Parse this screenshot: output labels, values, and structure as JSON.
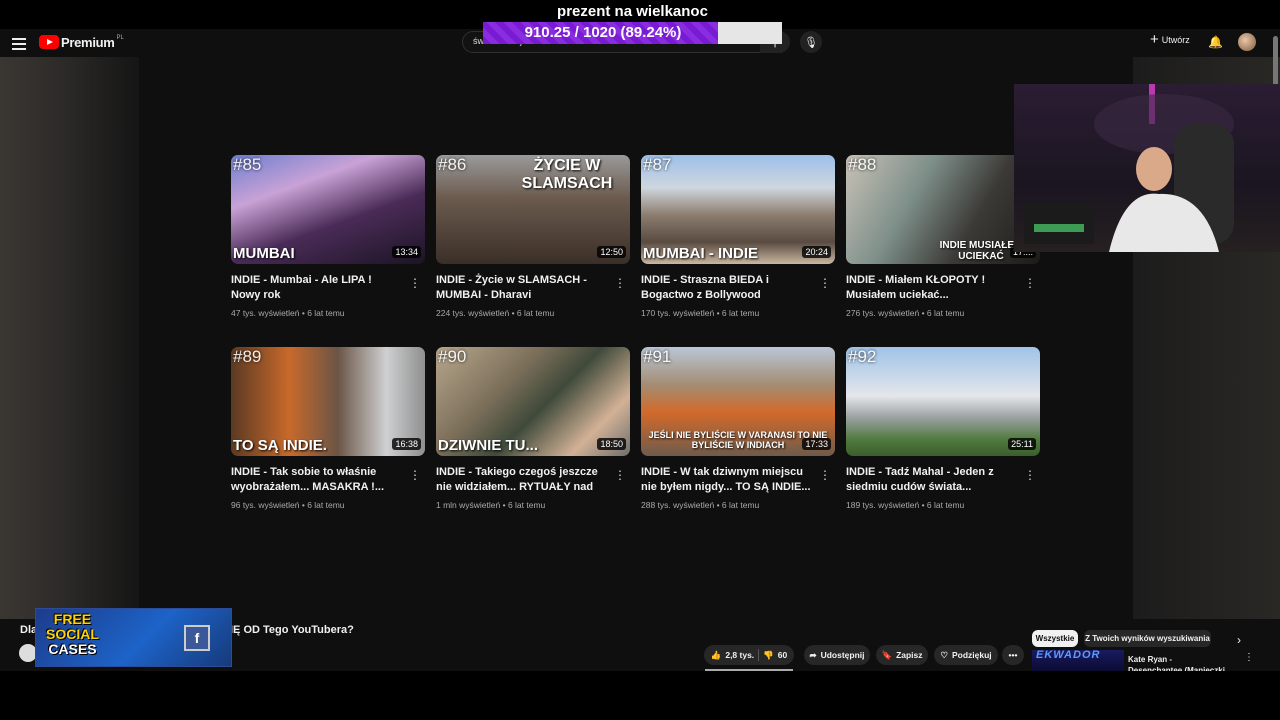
{
  "overlay": {
    "title": "prezent na wielkanoc",
    "progress_text": "910.25 / 1020 (89.24%)",
    "progress_fraction": 0.8924
  },
  "topbar": {
    "logo": "Premium",
    "logo_region": "PL",
    "search_value": "świat intencja",
    "create_label": "Utwórz"
  },
  "videos": [
    {
      "number": "#85",
      "caption": "MUMBAI",
      "duration": "13:34",
      "title": "INDIE - Mumbai - Ale LIPA ! Nowy rok",
      "meta": "47 tys. wyświetleń • 6 lat temu"
    },
    {
      "number": "#86",
      "caption": "ŻYCIE W SLAMSACH",
      "duration": "12:50",
      "title": "INDIE - Życie w SLAMSACH - MUMBAI - Dharavi",
      "meta": "224 tys. wyświetleń • 6 lat temu"
    },
    {
      "number": "#87",
      "caption": "MUMBAI - INDIE",
      "duration": "20:24",
      "title": "INDIE - Straszna BIEDA i Bogactwo z Bollywood",
      "meta": "170 tys. wyświetleń • 6 lat temu"
    },
    {
      "number": "#88",
      "caption": "INDIE MUSIAŁEM UCIEKAĆ",
      "duration": "17:...",
      "title": "INDIE - Miałem KŁOPOTY ! Musiałem uciekać...",
      "meta": "276 tys. wyświetleń • 6 lat temu"
    },
    {
      "number": "#89",
      "caption": "TO SĄ INDIE.",
      "duration": "16:38",
      "title": "INDIE - Tak sobie to właśnie wyobrażałem... MASAKRA !...",
      "meta": "96 tys. wyświetleń • 6 lat temu"
    },
    {
      "number": "#90",
      "caption": "DZIWNIE TU...",
      "duration": "18:50",
      "title": "INDIE - Takiego czegoś jeszcze nie widziałem... RYTUAŁY nad rzeką...",
      "meta": "1 mln wyświetleń • 6 lat temu"
    },
    {
      "number": "#91",
      "caption": "JEŚLI NIE BYLIŚCIE W VARANASI TO NIE BYLIŚCIE W INDIACH",
      "duration": "17:33",
      "title": "INDIE - W tak dziwnym miejscu nie byłem nigdy... TO SĄ INDIE...",
      "meta": "288 tys. wyświetleń • 6 lat temu"
    },
    {
      "number": "#92",
      "caption": "",
      "duration": "25:11",
      "title": "INDIE - Tadź Mahal - Jeden z siedmiu cudów świata...",
      "meta": "189 tys. wyświetleń • 6 lat temu"
    }
  ],
  "bottom": {
    "title_left": "Dla",
    "title_right": "IĘ OD Tego YouTubera?",
    "ad_line1": "FREE",
    "ad_line2": "SOCIAL",
    "ad_line3": "CASES",
    "like_count": "2,8 tys.",
    "dislike_count": "60",
    "share_label": "Udostępnij",
    "save_label": "Zapisz",
    "thanks_label": "Podziękuj",
    "more_label": "•••"
  },
  "sidebar": {
    "chip_all": "Wszystkie",
    "chip_search": "Z Twoich wyników wyszukiwania",
    "next_title": "Kate Ryan - Desenchantee (Manieczki Ekwador)",
    "next_thumb_text": "EKWADOR"
  },
  "colors": {
    "progress_fill": "#7a1bd4",
    "yt_red": "#ff0000"
  }
}
